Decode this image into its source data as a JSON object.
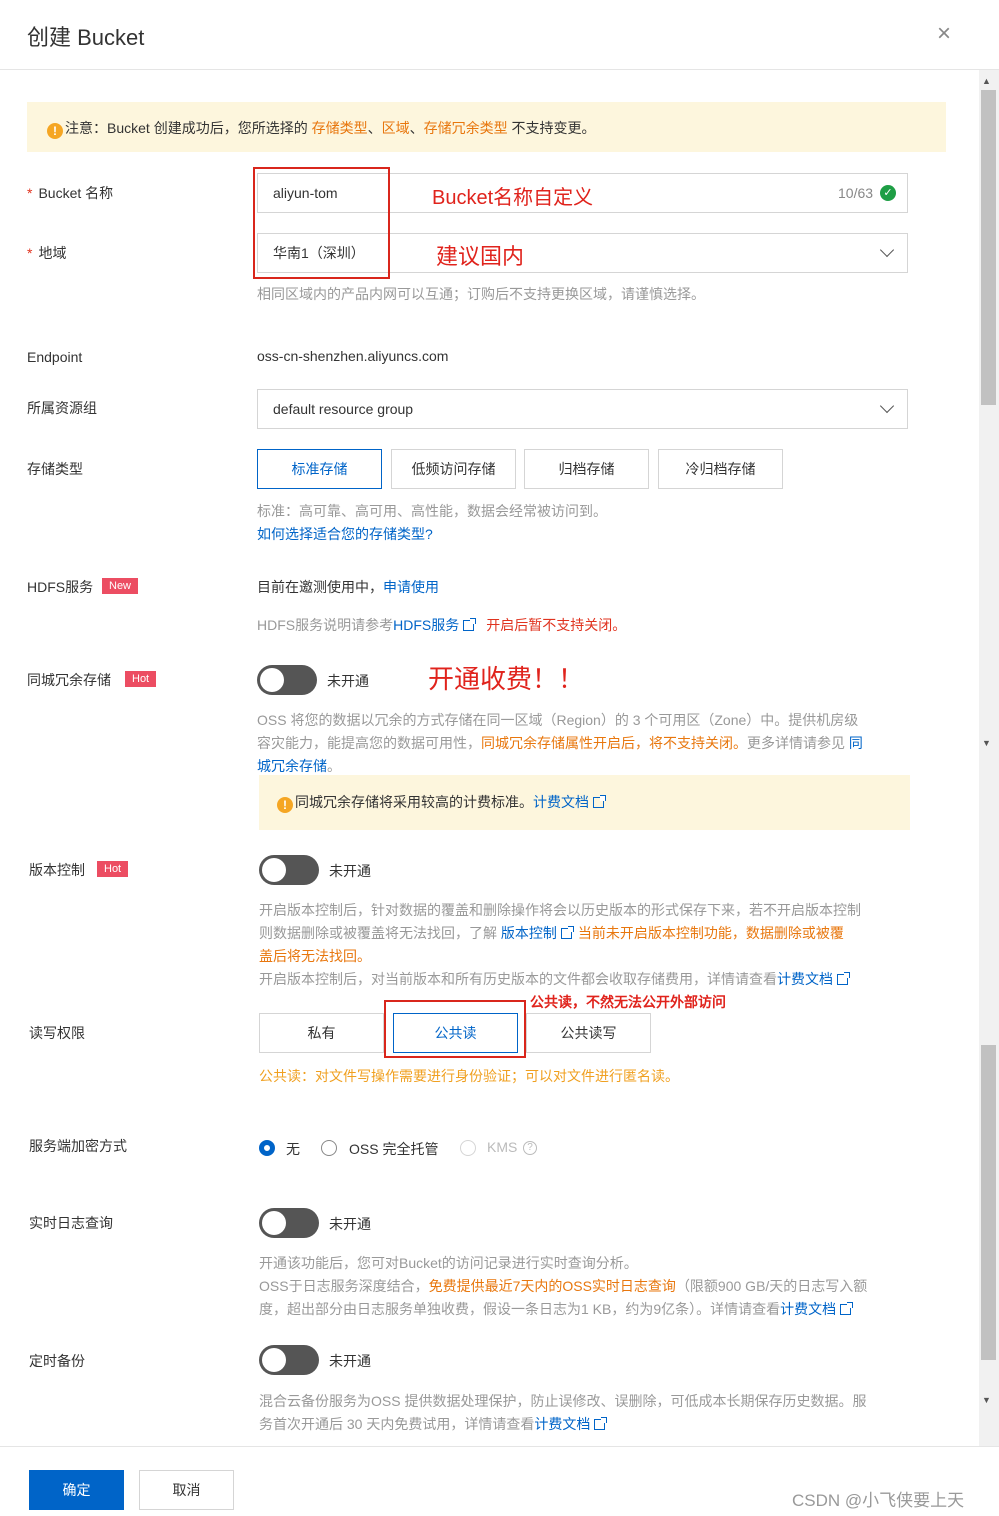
{
  "dialog": {
    "title": "创建 Bucket",
    "close_icon": "×"
  },
  "notice": {
    "prefix": "注意：Bucket 创建成功后，您所选择的 ",
    "link1": "存储类型",
    "sep1": "、",
    "link2": "区域",
    "sep2": "、",
    "link3": "存储冗余类型",
    "suffix": " 不支持变更。"
  },
  "bucket_name": {
    "label": "Bucket 名称",
    "value": "aliyun-tom",
    "count": "10/63",
    "annotation": "Bucket名称自定义"
  },
  "region": {
    "label": "地域",
    "value": "华南1（深圳）",
    "annotation": "建议国内",
    "hint": "相同区域内的产品内网可以互通；订购后不支持更换区域，请谨慎选择。"
  },
  "endpoint": {
    "label": "Endpoint",
    "value": "oss-cn-shenzhen.aliyuncs.com"
  },
  "resource_group": {
    "label": "所属资源组",
    "value": "default resource group"
  },
  "storage_type": {
    "label": "存储类型",
    "options": [
      "标准存储",
      "低频访问存储",
      "归档存储",
      "冷归档存储"
    ],
    "hint": "标准：高可靠、高可用、高性能，数据会经常被访问到。",
    "link": "如何选择适合您的存储类型?"
  },
  "hdfs": {
    "label": "HDFS服务",
    "tag": "New",
    "status": "目前在邀测使用中，",
    "apply": "申请使用",
    "hint_prefix": "HDFS服务说明请参考",
    "hint_link": "HDFS服务",
    "hint_warn": "开启后暂不支持关闭。"
  },
  "redundancy": {
    "label": "同城冗余存储",
    "tag": "Hot",
    "status": "未开通",
    "annotation": "开通收费！！",
    "hint1": "OSS 将您的数据以冗余的方式存储在同一区域（Region）的 3 个可用区（Zone）中。提供机房级",
    "hint2a": "容灾能力，能提高您的数据可用性，",
    "hint2b": "同城冗余存储属性开启后，将不支持关闭。",
    "hint2c": "更多详情请参见 ",
    "hint2d": "同",
    "hint3": "城冗余存储",
    "hint3b": "。",
    "warn": "同城冗余存储将采用较高的计费标准。",
    "warn_link": "计费文档"
  },
  "versioning": {
    "label": "版本控制",
    "tag": "Hot",
    "status": "未开通",
    "hint1": "开启版本控制后，针对数据的覆盖和删除操作将会以历史版本的形式保存下来，若不开启版本控制",
    "hint2a": "则数据删除或被覆盖将无法找回，了解 ",
    "hint2b": "版本控制",
    "hint2c": "当前未开启版本控制功能，数据删除或被覆",
    "hint3": "盖后将无法找回。",
    "hint4a": "开启版本控制后，对当前版本和所有历史版本的文件都会收取存储费用，详情请查看",
    "hint4b": "计费文档"
  },
  "acl": {
    "label": "读写权限",
    "options": [
      "私有",
      "公共读",
      "公共读写"
    ],
    "annotation": "公共读，不然无法公开外部访问",
    "hint": "公共读：对文件写操作需要进行身份验证；可以对文件进行匿名读。"
  },
  "encryption": {
    "label": "服务端加密方式",
    "options": [
      "无",
      "OSS 完全托管",
      "KMS"
    ],
    "help_icon": "?"
  },
  "realtime_log": {
    "label": "实时日志查询",
    "status": "未开通",
    "hint1": "开通该功能后，您可对Bucket的访问记录进行实时查询分析。",
    "hint2a": "OSS于日志服务深度结合，",
    "hint2b": "免费提供最近7天内的OSS实时日志查询",
    "hint2c": "（限额900 GB/天的日志写入额",
    "hint3a": "度，超出部分由日志服务单独收费，假设一条日志为1 KB，约为9亿条）。详情请查看",
    "hint3b": "计费文档"
  },
  "backup": {
    "label": "定时备份",
    "status": "未开通",
    "hint1": "混合云备份服务为OSS 提供数据处理保护，防止误修改、误删除，可低成本长期保存历史数据。服",
    "hint2a": "务首次开通后 30 天内免费试用，详情请查看",
    "hint2b": "计费文档"
  },
  "footer": {
    "confirm": "确定",
    "cancel": "取消",
    "watermark": "CSDN @小飞侠要上天"
  },
  "colors": {
    "primary": "#0064c8",
    "warning": "#e8770e",
    "annotation": "#e0231c",
    "tag": "#ec4d62"
  }
}
